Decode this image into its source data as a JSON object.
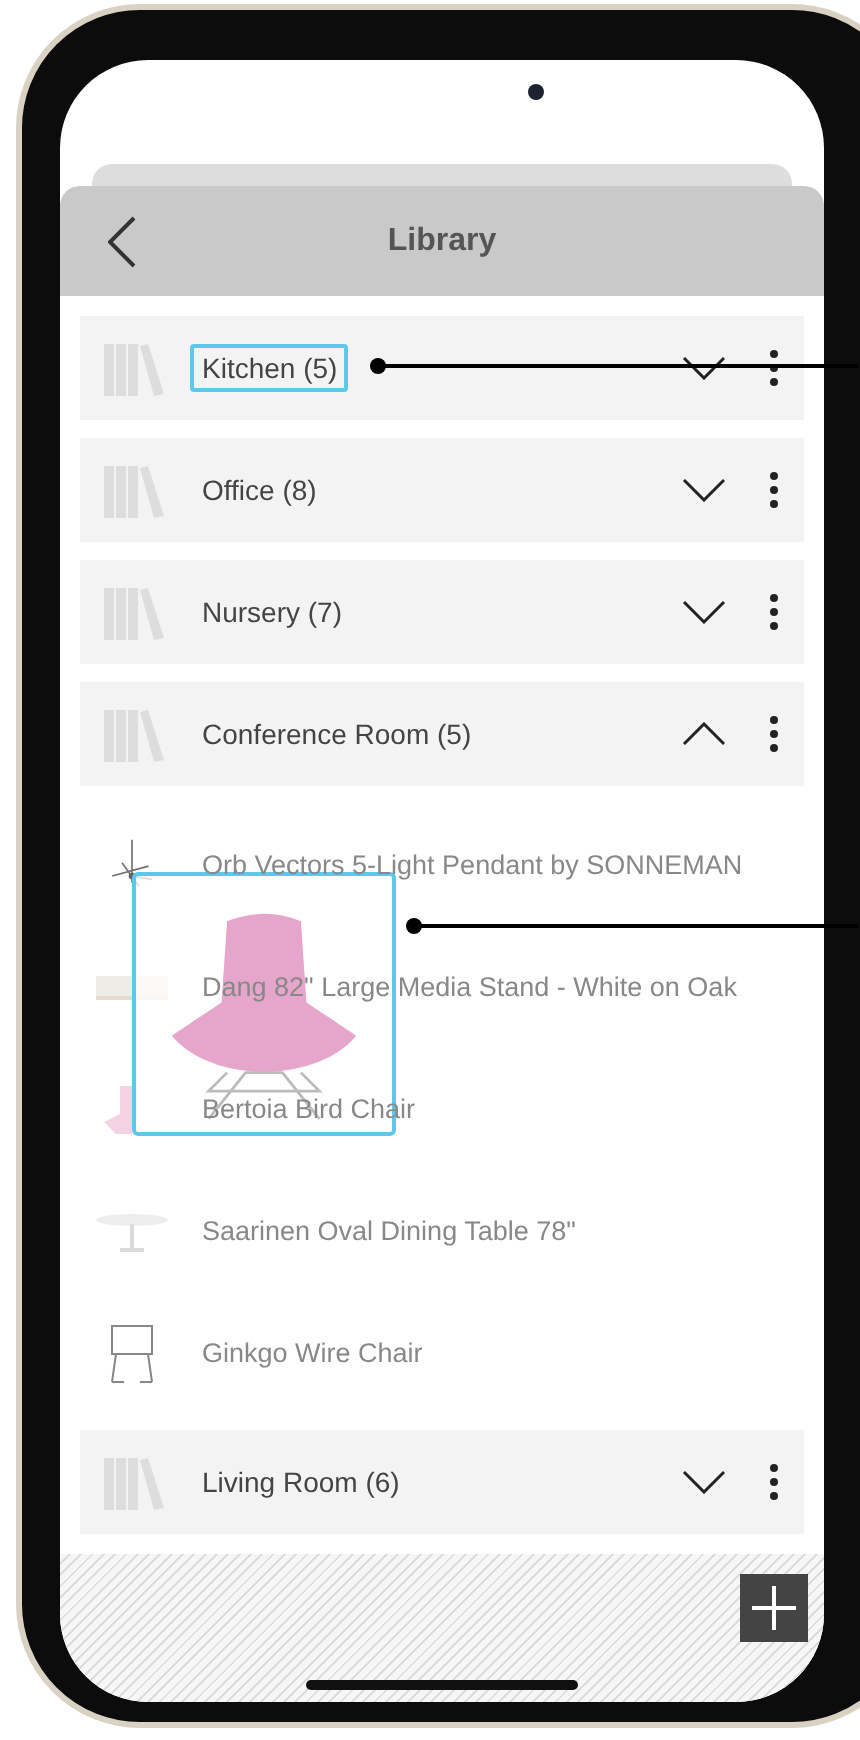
{
  "header": {
    "title": "Library"
  },
  "groups": [
    {
      "name": "Kitchen (5)",
      "expanded": false,
      "highlighted": true
    },
    {
      "name": "Office (8)",
      "expanded": false,
      "highlighted": false
    },
    {
      "name": "Nursery (7)",
      "expanded": false,
      "highlighted": false
    },
    {
      "name": "Conference Room (5)",
      "expanded": true,
      "highlighted": false,
      "items": [
        {
          "name": "Orb Vectors 5-Light Pendant by SONNEMAN",
          "kind": "pendant"
        },
        {
          "name": "Dang 82\" Large Media Stand - White on Oak",
          "kind": "stand"
        },
        {
          "name": "Bertoia Bird Chair",
          "kind": "chair"
        },
        {
          "name": "Saarinen Oval Dining Table 78\"",
          "kind": "table"
        },
        {
          "name": "Ginkgo Wire Chair",
          "kind": "wire-chair"
        }
      ]
    },
    {
      "name": "Living Room (6)",
      "expanded": false,
      "highlighted": false
    }
  ]
}
